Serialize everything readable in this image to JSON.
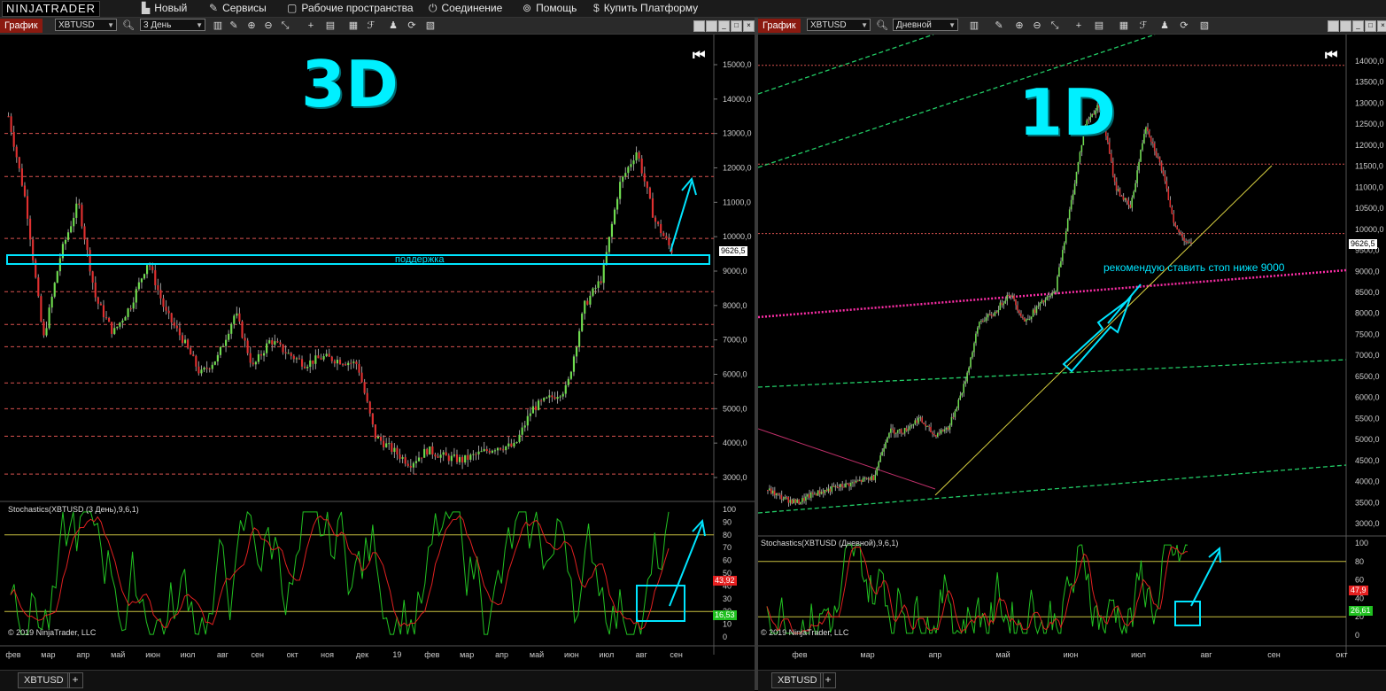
{
  "app": {
    "logo": "NINJATRADER",
    "menu": [
      {
        "icon": "new-icon",
        "glyph": "▙",
        "label": "Новый"
      },
      {
        "icon": "tools-icon",
        "glyph": "✎",
        "label": "Сервисы"
      },
      {
        "icon": "workspace-icon",
        "glyph": "▢",
        "label": "Рабочие пространства"
      },
      {
        "icon": "plug-icon",
        "glyph": "⏻",
        "label": "Соединение"
      },
      {
        "icon": "help-icon",
        "glyph": "⊚",
        "label": "Помощь"
      },
      {
        "icon": "dollar-icon",
        "glyph": "$",
        "label": "Купить Платформу"
      }
    ]
  },
  "left": {
    "tab": "График",
    "instrument": "XBTUSD",
    "period": "3 День",
    "watermark": "3D",
    "support_label": "поддержка",
    "price_tag": "9626,5",
    "price_axis": [
      "15000,0",
      "14000,0",
      "13000,0",
      "12000,0",
      "11000,0",
      "10000,0",
      "9000,0",
      "8000,0",
      "7000,0",
      "6000,0",
      "5000,0",
      "4000,0",
      "3000,0"
    ],
    "indicator_title": "Stochastics(XBTUSD (3 День),9,6,1)",
    "osc_axis": [
      "100",
      "90",
      "80",
      "70",
      "60",
      "50",
      "40",
      "30",
      "20",
      "10",
      "0"
    ],
    "osc_values": {
      "d": "43,92",
      "k": "16,53"
    },
    "time_axis": [
      "фев",
      "мар",
      "апр",
      "май",
      "июн",
      "июл",
      "авг",
      "сен",
      "окт",
      "ноя",
      "дек",
      "19",
      "фев",
      "мар",
      "апр",
      "май",
      "июн",
      "июл",
      "авг",
      "сен"
    ],
    "copyright": "© 2019 NinjaTrader, LLC",
    "bottom_tab": "XBTUSD"
  },
  "right": {
    "tab": "График",
    "instrument": "XBTUSD",
    "period": "Дневной",
    "watermark": "1D",
    "note": "рекомендую ставить стоп ниже 9000",
    "price_tag": "9626,5",
    "price_axis": [
      "14000,0",
      "13500,0",
      "13000,0",
      "12500,0",
      "12000,0",
      "11500,0",
      "11000,0",
      "10500,0",
      "10000,0",
      "9500,0",
      "9000,0",
      "8500,0",
      "8000,0",
      "7500,0",
      "7000,0",
      "6500,0",
      "6000,0",
      "5500,0",
      "5000,0",
      "4500,0",
      "4000,0",
      "3500,0",
      "3000,0"
    ],
    "indicator_title": "Stochastics(XBTUSD (Дневной),9,6,1)",
    "osc_axis": [
      "100",
      "80",
      "60",
      "40",
      "20",
      "0"
    ],
    "osc_values": {
      "d": "47,9",
      "k": "26,61"
    },
    "time_axis": [
      "фев",
      "мар",
      "апр",
      "май",
      "июн",
      "июл",
      "авг",
      "сен",
      "окт"
    ],
    "copyright": "© 2019 NinjaTrader, LLC",
    "bottom_tab": "XBTUSD"
  },
  "colors": {
    "watermark": "#00f0ff",
    "bull": "#6fdc4f",
    "bear": "#e03030",
    "level_line": "#d9534f",
    "stoch_k": "#22c222",
    "stoch_d": "#e02020",
    "trend_yellow": "#d8d040",
    "trend_green": "#22cc66",
    "pink_dotted": "#ff2ea8"
  }
}
